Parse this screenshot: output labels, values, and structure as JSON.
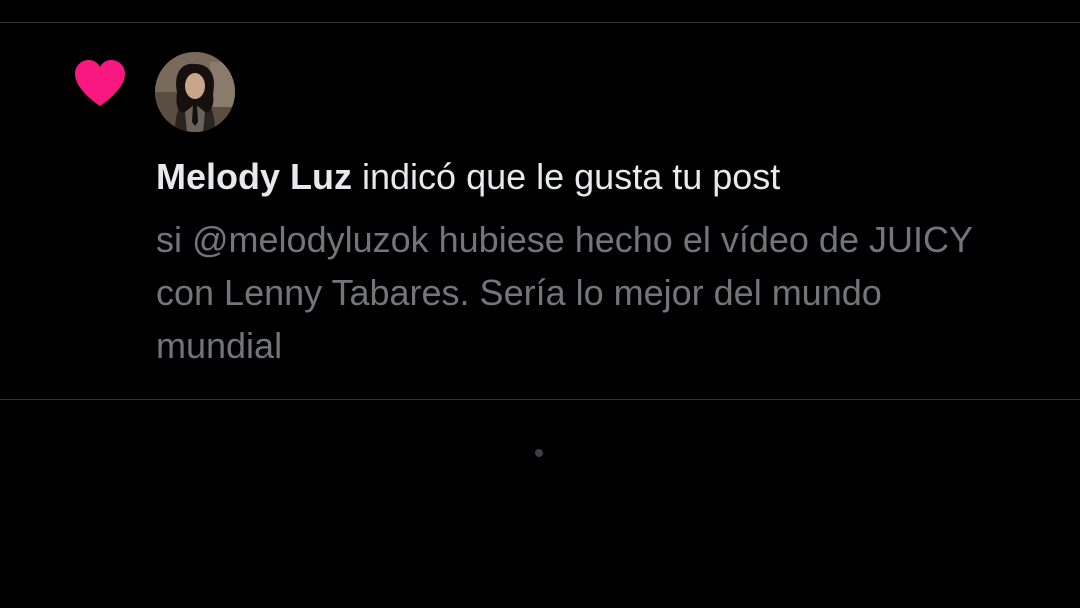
{
  "colors": {
    "background": "#000000",
    "like_heart": "#f91880",
    "primary_text": "#e7e9ea",
    "secondary_text": "#71767b",
    "divider": "#2f3336"
  },
  "notification": {
    "type_icon": "heart-icon",
    "avatar_icon": "user-avatar",
    "user_name": "Melody Luz",
    "action_text": " indicó que le gusta tu post",
    "tweet_text": "si @melodyluzok hubiese hecho el vídeo de JUICY con Lenny Tabares. Sería lo mejor del mundo mundial"
  },
  "loading": {
    "icon": "loading-dot-icon"
  }
}
